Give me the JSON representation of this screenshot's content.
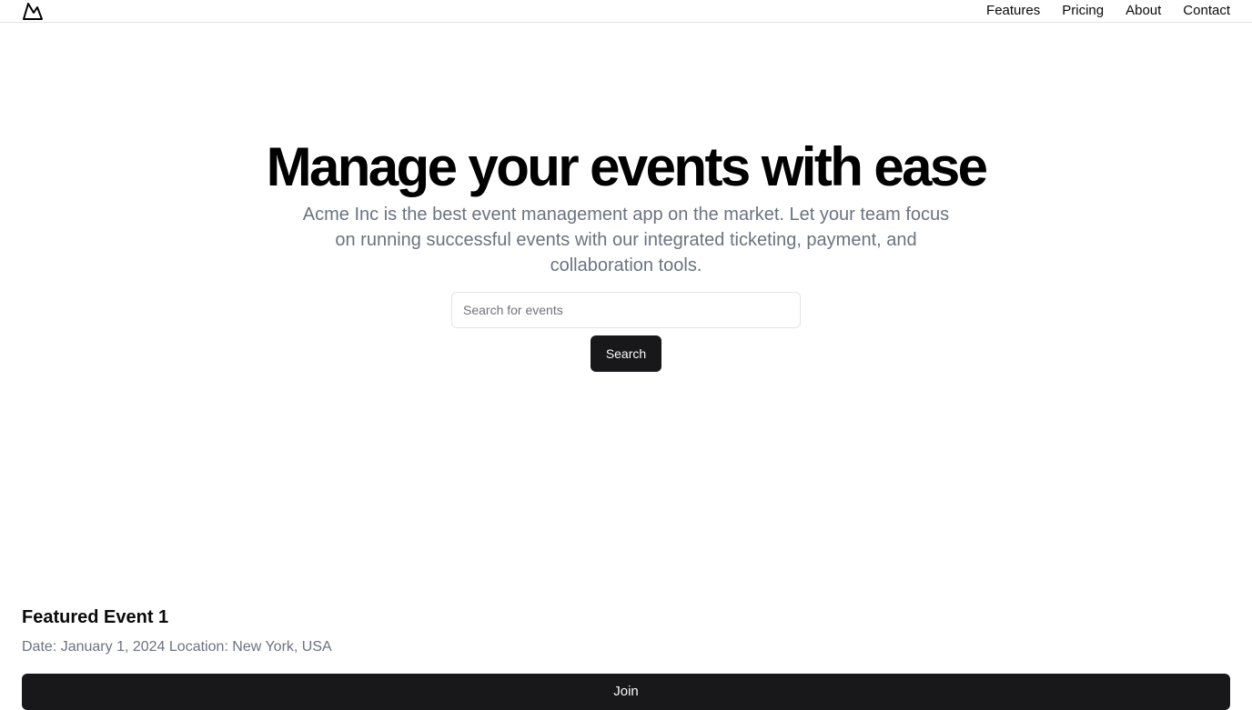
{
  "header": {
    "logo_icon": "mountain-icon",
    "nav": [
      {
        "label": "Features"
      },
      {
        "label": "Pricing"
      },
      {
        "label": "About"
      },
      {
        "label": "Contact"
      }
    ]
  },
  "hero": {
    "title": "Manage your events with ease",
    "description": "Acme Inc is the best event management app on the market. Let your team focus on running successful events with our integrated ticketing, payment, and collaboration tools."
  },
  "search": {
    "placeholder": "Search for events",
    "value": "",
    "button_label": "Search"
  },
  "featured_event": {
    "title": "Featured Event 1",
    "date_label": "Date:",
    "date": "January 1, 2024",
    "location_label": "Location:",
    "location": "New York, USA",
    "join_label": "Join"
  },
  "colors": {
    "primary": "#18181b",
    "muted_text": "#6b7280",
    "border": "#e4e4e7"
  }
}
